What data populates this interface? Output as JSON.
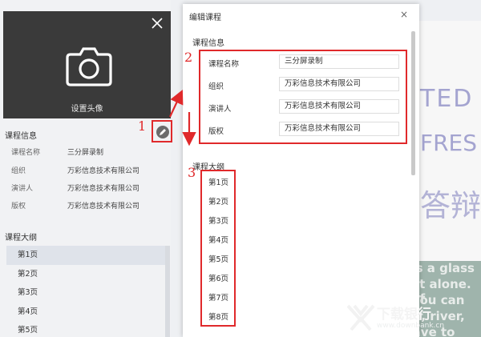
{
  "left": {
    "avatar_label": "设置头像",
    "info_title": "课程信息",
    "info": [
      {
        "key": "课程名称",
        "value": "三分屏录制"
      },
      {
        "key": "组织",
        "value": "万彩信息技术有限公司"
      },
      {
        "key": "演讲人",
        "value": "万彩信息技术有限公司"
      },
      {
        "key": "版权",
        "value": "万彩信息技术有限公司"
      }
    ],
    "outline_title": "课程大纲",
    "outline": [
      "第1页",
      "第2页",
      "第3页",
      "第4页",
      "第5页"
    ]
  },
  "annotations": {
    "n1": "1",
    "n2": "2",
    "n3": "3"
  },
  "dialog": {
    "title": "编辑课程",
    "close": "×",
    "info_title": "课程信息",
    "fields": [
      {
        "label": "课程名称",
        "value": "三分屏录制"
      },
      {
        "label": "组织",
        "value": "万彩信息技术有限公司"
      },
      {
        "label": "演讲人",
        "value": "万彩信息技术有限公司"
      },
      {
        "label": "版权",
        "value": "万彩信息技术有限公司"
      }
    ],
    "outline_title": "课程大纲",
    "outline": [
      "第1页",
      "第2页",
      "第3页",
      "第4页",
      "第5页",
      "第6页",
      "第7页",
      "第8页"
    ]
  },
  "background": {
    "text1": "TED",
    "text2": "FRES",
    "text3": "答辩",
    "lines": [
      "'s a glass",
      "it alone. If",
      "You can",
      "er, river,",
      "have to leave it."
    ]
  },
  "watermark": {
    "name": "下载银行",
    "url": "www.downbank.cn"
  },
  "colors": {
    "accent": "#e0292b",
    "dark_panel": "#3a3a3a"
  }
}
